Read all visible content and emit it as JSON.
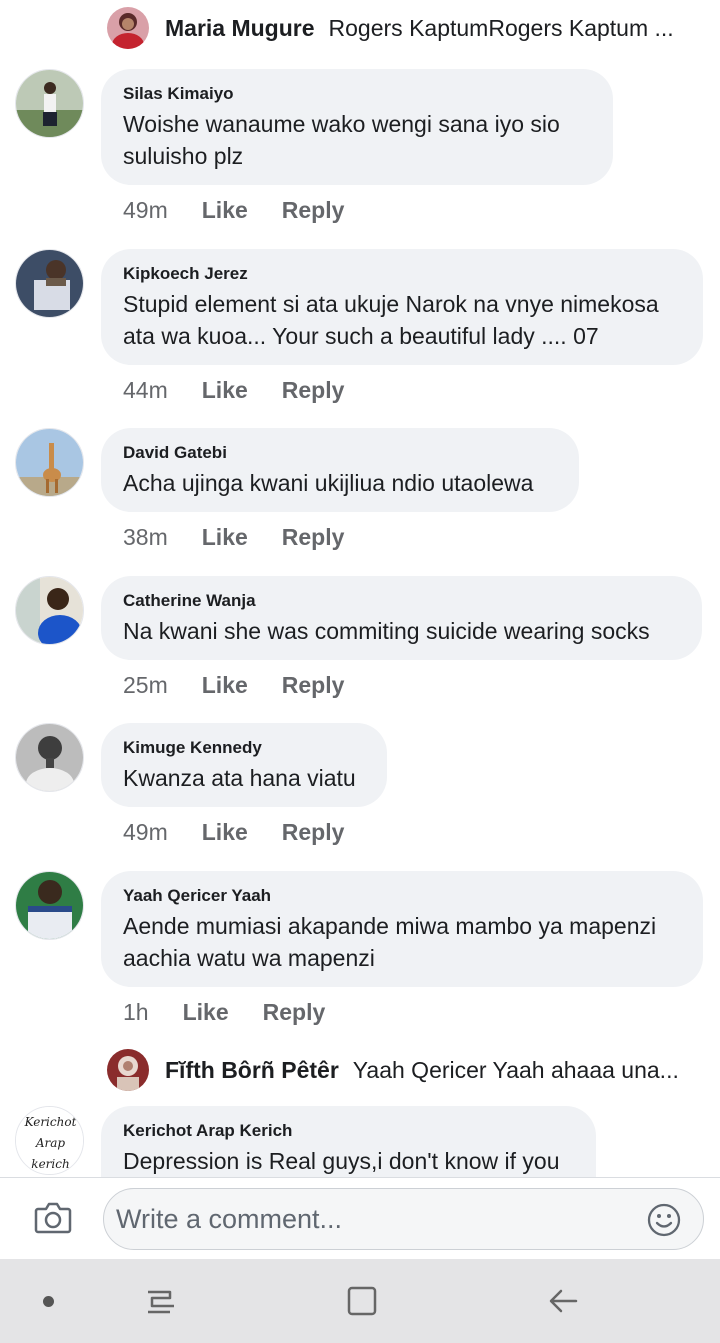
{
  "reply_previews": [
    {
      "name": "Maria Mugure",
      "text": "Rogers KaptumRogers Kaptum ..."
    },
    {
      "name": "Fĭfth Bôrñ Pêtêr",
      "text": "Yaah Qericer Yaah ahaaa una..."
    }
  ],
  "comments": [
    {
      "author": "Silas Kimaiyo",
      "text": "Woishe wanaume  wako wengi sana  iyo sio suluisho plz",
      "time": "49m",
      "like": "Like",
      "reply": "Reply"
    },
    {
      "author": "Kipkoech Jerez",
      "text": "Stupid element si ata ukuje Narok na vnye nimekosa ata wa kuoa... Your such a beautiful lady .... 07",
      "time": "44m",
      "like": "Like",
      "reply": "Reply"
    },
    {
      "author": "David Gatebi",
      "text": "Acha ujinga kwani ukijliua ndio utaolewa",
      "time": "38m",
      "like": "Like",
      "reply": "Reply"
    },
    {
      "author": "Catherine Wanja",
      "text": "Na kwani she was commiting suicide wearing socks",
      "time": "25m",
      "like": "Like",
      "reply": "Reply"
    },
    {
      "author": "Kimuge Kennedy",
      "text": "Kwanza ata hana viatu",
      "time": "49m",
      "like": "Like",
      "reply": "Reply"
    },
    {
      "author": "Yaah Qericer Yaah",
      "text": "Aende mumiasi akapande miwa mambo ya mapenzi aachia watu wa mapenzi",
      "time": "1h",
      "like": "Like",
      "reply": "Reply"
    },
    {
      "author": "Kerichot Arap Kerich",
      "text": "Depression is Real guys,i don't know if you",
      "time": "",
      "like": "",
      "reply": ""
    }
  ],
  "kerich_logo": [
    "Kerichot",
    "Arap",
    "kerich"
  ],
  "composer": {
    "placeholder": "Write a comment..."
  },
  "icons": {
    "camera": "camera-icon",
    "emoji": "emoji-icon",
    "recents": "recents-icon",
    "home": "home-icon",
    "back": "back-icon"
  }
}
